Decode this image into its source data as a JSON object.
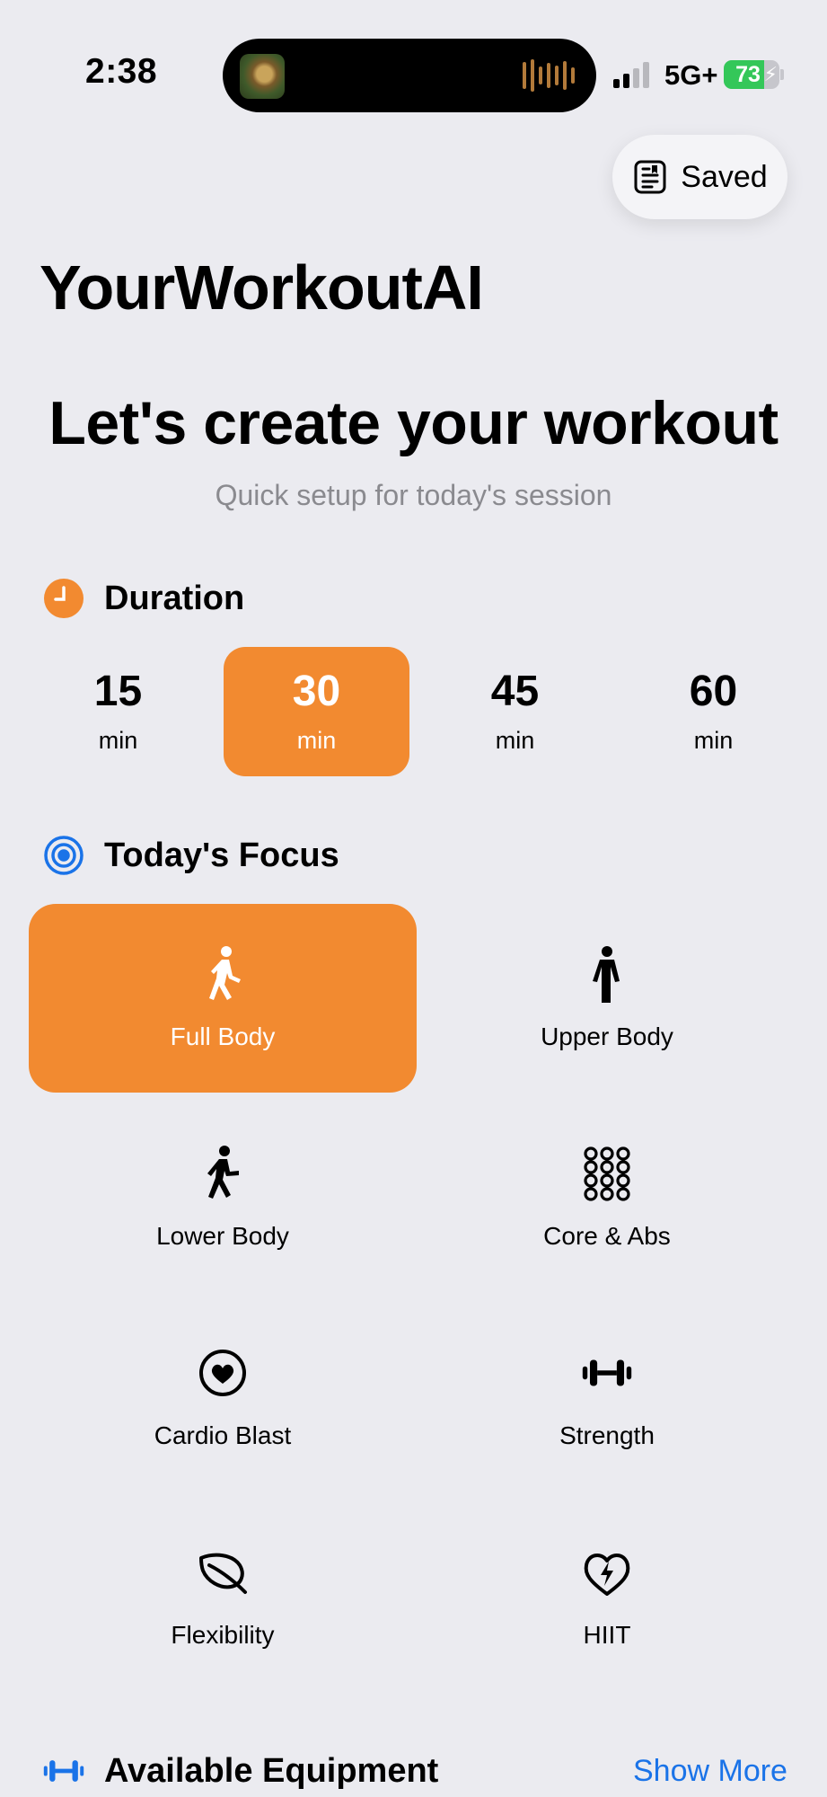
{
  "status_bar": {
    "time": "2:38",
    "network": "5G+",
    "battery": "73",
    "battery_level": 0.73
  },
  "header": {
    "saved_label": "Saved"
  },
  "app_title": "YourWorkoutAI",
  "headline": "Let's create your workout",
  "subheadline": "Quick setup for today's session",
  "duration": {
    "title": "Duration",
    "options": [
      {
        "value": "15",
        "unit": "min"
      },
      {
        "value": "30",
        "unit": "min"
      },
      {
        "value": "45",
        "unit": "min"
      },
      {
        "value": "60",
        "unit": "min"
      }
    ],
    "selected": "30"
  },
  "focus": {
    "title": "Today's Focus",
    "options": [
      {
        "label": "Full Body",
        "icon": "figure-walk-icon"
      },
      {
        "label": "Upper Body",
        "icon": "figure-stand-icon"
      },
      {
        "label": "Lower Body",
        "icon": "figure-run-icon"
      },
      {
        "label": "Core & Abs",
        "icon": "grid-dots-icon"
      },
      {
        "label": "Cardio Blast",
        "icon": "heart-circle-icon"
      },
      {
        "label": "Strength",
        "icon": "dumbbell-icon"
      },
      {
        "label": "Flexibility",
        "icon": "leaf-icon"
      },
      {
        "label": "HIIT",
        "icon": "heart-bolt-icon"
      }
    ],
    "selected": "Full Body"
  },
  "equipment": {
    "title": "Available Equipment",
    "show_more_label": "Show More"
  },
  "colors": {
    "accent": "#f28a30",
    "link": "#1a73e8",
    "background": "#ebebf0",
    "battery": "#34c759",
    "focus_icon": "#1a73e8"
  }
}
